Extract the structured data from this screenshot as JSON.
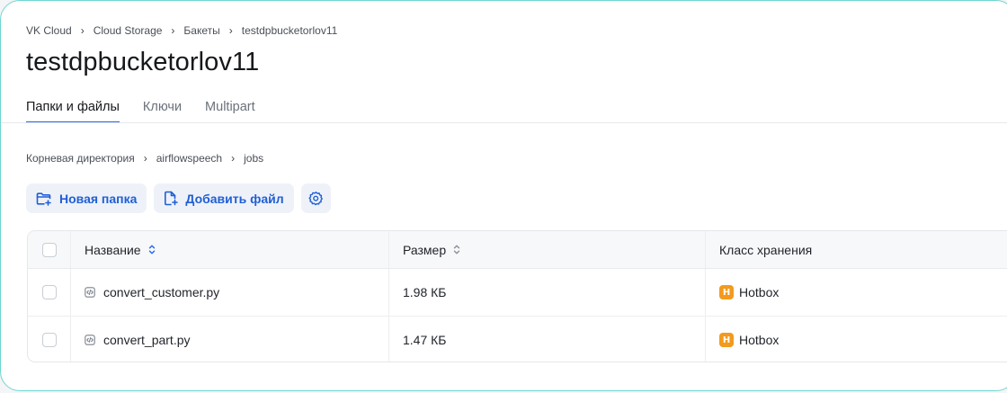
{
  "breadcrumb": [
    "VK Cloud",
    "Cloud Storage",
    "Бакеты",
    "testdpbucketorlov11"
  ],
  "page_title": "testdpbucketorlov11",
  "tabs": [
    {
      "label": "Папки и файлы",
      "active": true
    },
    {
      "label": "Ключи",
      "active": false
    },
    {
      "label": "Multipart",
      "active": false
    }
  ],
  "path": [
    "Корневая директория",
    "airflowspeech",
    "jobs"
  ],
  "actions": {
    "new_folder": "Новая папка",
    "add_file": "Добавить файл",
    "settings_icon": "gear-icon"
  },
  "table": {
    "columns": [
      "Название",
      "Размер",
      "Класс хранения"
    ],
    "rows": [
      {
        "name": "convert_customer.py",
        "size": "1.98 КБ",
        "class_badge": "H",
        "class": "Hotbox"
      },
      {
        "name": "convert_part.py",
        "size": "1.47 КБ",
        "class_badge": "H",
        "class": "Hotbox"
      }
    ]
  },
  "colors": {
    "accent": "#2468f2",
    "button_text": "#1f5fd6",
    "button_bg": "#eef2f8",
    "hotbox_badge": "#f39a1e",
    "frame_border": "#6fd6d0"
  }
}
